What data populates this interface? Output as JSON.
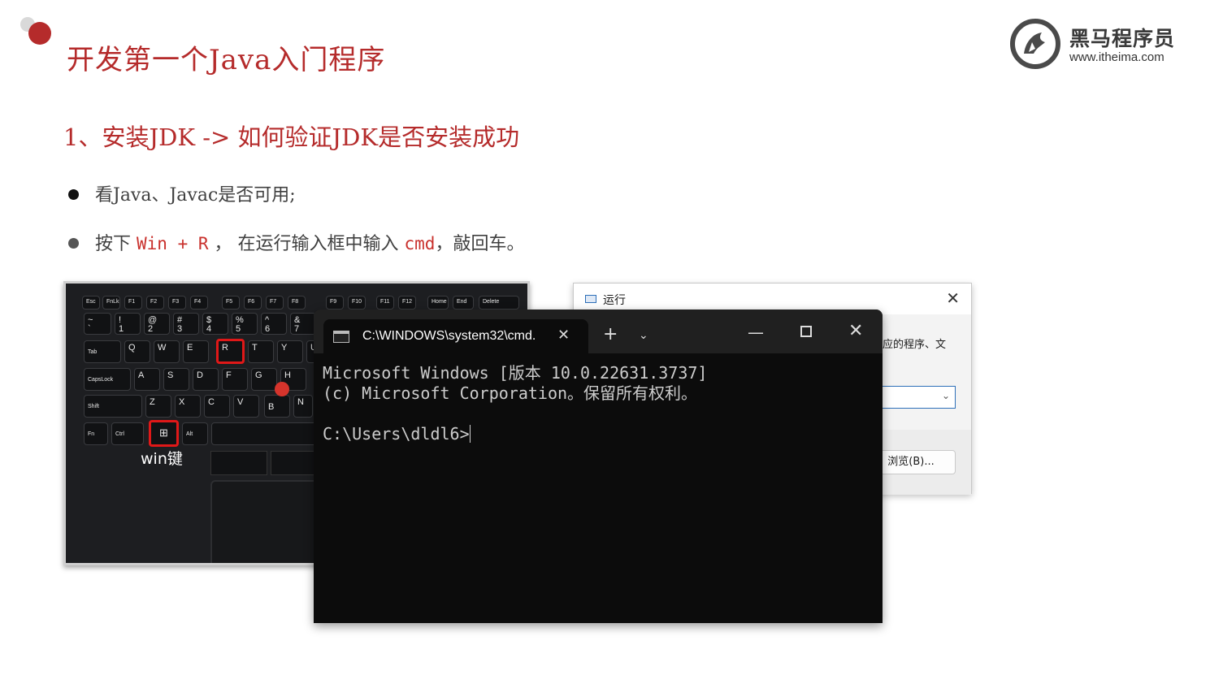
{
  "slide": {
    "title": "开发第一个Java入门程序",
    "section_title": "1、安装JDK -> 如何验证JDK是否安装成功",
    "bullets": [
      {
        "text": "看Java、Javac是否可用;"
      },
      {
        "prefix": "按下 ",
        "highlight1": "Win + R",
        "middle": " ， 在运行输入框中输入 ",
        "highlight2": "cmd",
        "suffix": "，敲回车。"
      }
    ]
  },
  "logo": {
    "name": "黑马程序员",
    "url": "www.itheima.com"
  },
  "keyboard": {
    "win_label": "win键",
    "fn_row": [
      "Esc",
      "FnLk",
      "F1",
      "F2",
      "F3",
      "F4",
      "F5",
      "F6",
      "F7",
      "F8",
      "F9",
      "F10",
      "F11",
      "F12",
      "Home",
      "End",
      "Delete"
    ],
    "num_row": [
      "~",
      "!",
      "@",
      "#",
      "$",
      "%",
      "^",
      "&"
    ],
    "num_row_sub": [
      "`",
      "1",
      "2",
      "3",
      "4",
      "5",
      "6",
      "7"
    ],
    "q_row": [
      "Tab",
      "Q",
      "W",
      "E",
      "R",
      "T",
      "Y",
      "U"
    ],
    "a_row": [
      "CapsLock",
      "A",
      "S",
      "D",
      "F",
      "G",
      "H"
    ],
    "z_row": [
      "Shift",
      "Z",
      "X",
      "C",
      "V",
      "B",
      "N"
    ],
    "bottom_row": [
      "Fn",
      "Ctrl",
      "⊞",
      "Alt"
    ]
  },
  "run_dialog": {
    "title": "运行",
    "close": "✕",
    "description_partial": "应的程序、文",
    "browse_label": "浏览(B)...",
    "dropdown_chevron": "⌄"
  },
  "terminal": {
    "tab_title": "C:\\WINDOWS\\system32\\cmd.",
    "tab_close": "✕",
    "new_tab": "+",
    "dropdown": "⌄",
    "minimize": "—",
    "close": "✕",
    "lines": [
      "Microsoft Windows [版本 10.0.22631.3737]",
      "(c) Microsoft Corporation。保留所有权利。",
      "",
      "C:\\Users\\dldl6>"
    ]
  },
  "colors": {
    "accent_red": "#b52b2b",
    "highlight_red": "#c9302c",
    "terminal_bg": "#0c0c0c",
    "tabbar_bg": "#202020"
  }
}
